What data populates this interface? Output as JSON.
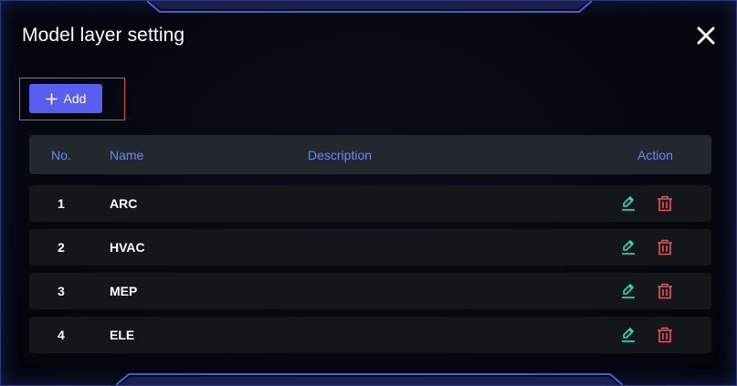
{
  "dialog": {
    "title": "Model layer setting",
    "close_icon": "close-icon",
    "add_label": "Add",
    "add_icon": "plus-icon"
  },
  "table": {
    "columns": {
      "no": "No.",
      "name": "Name",
      "description": "Description",
      "action": "Action"
    },
    "rows": [
      {
        "no": "1",
        "name": "ARC",
        "description": ""
      },
      {
        "no": "2",
        "name": "HVAC",
        "description": ""
      },
      {
        "no": "3",
        "name": "MEP",
        "description": ""
      },
      {
        "no": "4",
        "name": "ELE",
        "description": ""
      }
    ],
    "action_icons": [
      "edit-icon",
      "trash-icon"
    ]
  },
  "colors": {
    "accent": "#5a5ef0",
    "header_text": "#6b8ae8",
    "edit": "#2fd8c4",
    "delete": "#f0525a",
    "highlight_border": "#e2504b"
  }
}
